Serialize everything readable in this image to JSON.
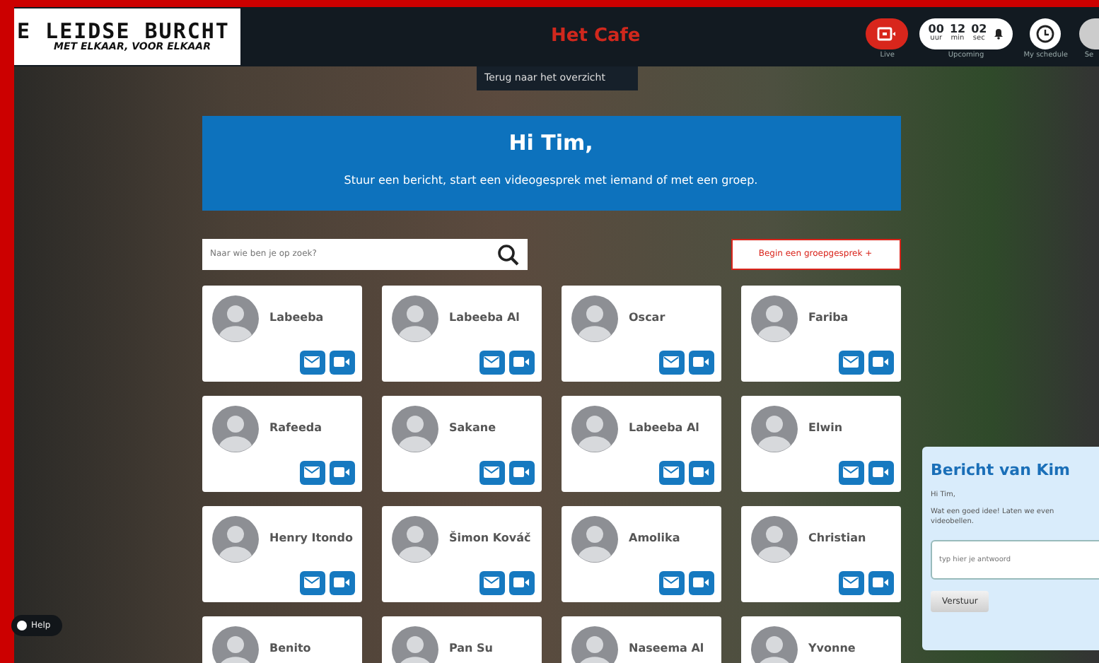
{
  "header": {
    "logo": {
      "title": "E LEIDSE BURCHT",
      "subtitle": "MET ELKAAR, VOOR ELKAAR"
    },
    "title": "Het Cafe",
    "live_label": "Live",
    "timer": [
      {
        "value": "00",
        "unit": "uur"
      },
      {
        "value": "12",
        "unit": "min"
      },
      {
        "value": "02",
        "unit": "sec"
      }
    ],
    "upcoming_label": "Upcoming",
    "schedule_label": "My schedule",
    "cut_label": "Se"
  },
  "back_link": "Terug naar het overzicht",
  "greeting": {
    "title": "Hi Tim,",
    "text": "Stuur een bericht, start een videogesprek met iemand of met een groep."
  },
  "search": {
    "placeholder": "Naar wie ben je op zoek?"
  },
  "group_button": "Begin een groepgesprek +",
  "contacts": [
    {
      "name": "Labeeba"
    },
    {
      "name": "Labeeba Al"
    },
    {
      "name": "Oscar"
    },
    {
      "name": "Fariba"
    },
    {
      "name": "Rafeeda"
    },
    {
      "name": "Sakane"
    },
    {
      "name": "Labeeba Al"
    },
    {
      "name": "Elwin"
    },
    {
      "name": "Henry Itondo"
    },
    {
      "name": "Šimon Kováč"
    },
    {
      "name": "Amolika"
    },
    {
      "name": "Christian"
    },
    {
      "name": "Benito"
    },
    {
      "name": "Pan Su"
    },
    {
      "name": "Naseema Al"
    },
    {
      "name": "Yvonne"
    }
  ],
  "message": {
    "title": "Bericht van Kim",
    "lines": [
      "Hi Tim,",
      "Wat een goed idee! Laten we even videobellen."
    ],
    "reply_placeholder": "typ hier je antwoord",
    "send": "Verstuur"
  },
  "help": "Help"
}
